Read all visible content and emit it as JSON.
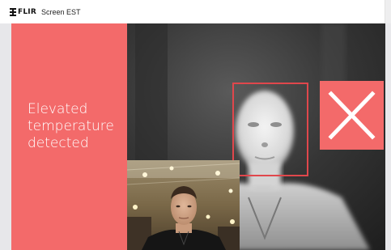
{
  "header": {
    "brand": "FLIR",
    "app_name": "Screen EST"
  },
  "alert": {
    "line1": "Elevated",
    "line2": "temperature",
    "line3": "detected",
    "color": "#f36a6a"
  },
  "status": {
    "icon": "close-icon",
    "state": "fail"
  },
  "colors": {
    "alert_red": "#f36a6a",
    "box_red": "#e0474c"
  }
}
